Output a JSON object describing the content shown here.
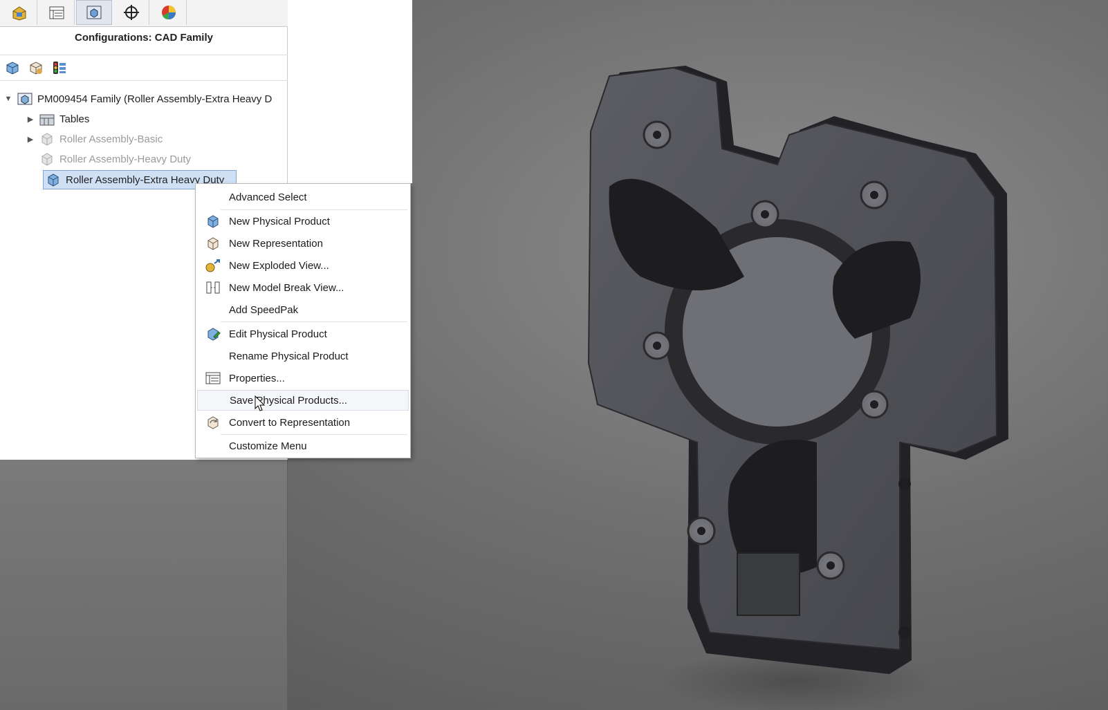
{
  "panel": {
    "title": "Configurations: CAD Family",
    "tabs": [
      {
        "icon": "feature-manager-icon"
      },
      {
        "icon": "property-manager-icon"
      },
      {
        "icon": "configuration-manager-icon"
      },
      {
        "icon": "dimxpert-icon"
      },
      {
        "icon": "display-manager-icon"
      }
    ],
    "toolbar": [
      {
        "icon": "physical-product-icon"
      },
      {
        "icon": "representation-icon"
      },
      {
        "icon": "show-suppressed-icon"
      }
    ]
  },
  "tree": {
    "root": "PM009454 Family  (Roller Assembly-Extra Heavy D",
    "items": [
      {
        "label": "Tables"
      },
      {
        "label": "Roller Assembly-Basic"
      },
      {
        "label": "Roller Assembly-Heavy Duty"
      },
      {
        "label": "Roller Assembly-Extra Heavy Duty"
      }
    ]
  },
  "context_menu": {
    "items": [
      {
        "label": "Advanced Select",
        "icon": ""
      },
      {
        "label": "New Physical Product",
        "icon": "physical-product-icon"
      },
      {
        "label": "New Representation",
        "icon": "representation-icon"
      },
      {
        "label": "New Exploded View...",
        "icon": "exploded-view-icon"
      },
      {
        "label": "New Model Break View...",
        "icon": "model-break-icon"
      },
      {
        "label": "Add SpeedPak",
        "icon": ""
      },
      {
        "label": "Edit Physical Product",
        "icon": "edit-product-icon"
      },
      {
        "label": "Rename Physical Product",
        "icon": ""
      },
      {
        "label": "Properties...",
        "icon": "properties-icon"
      },
      {
        "label": "Save Physical Products...",
        "icon": ""
      },
      {
        "label": "Convert to Representation",
        "icon": "convert-icon"
      },
      {
        "label": "Customize Menu",
        "icon": ""
      }
    ],
    "hovered": "Save Physical Products..."
  },
  "colors": {
    "selection": "#cfe0f5",
    "part_dark": "#2b2b2e",
    "part_face": "#55565b",
    "background": "#6f6f6f"
  }
}
